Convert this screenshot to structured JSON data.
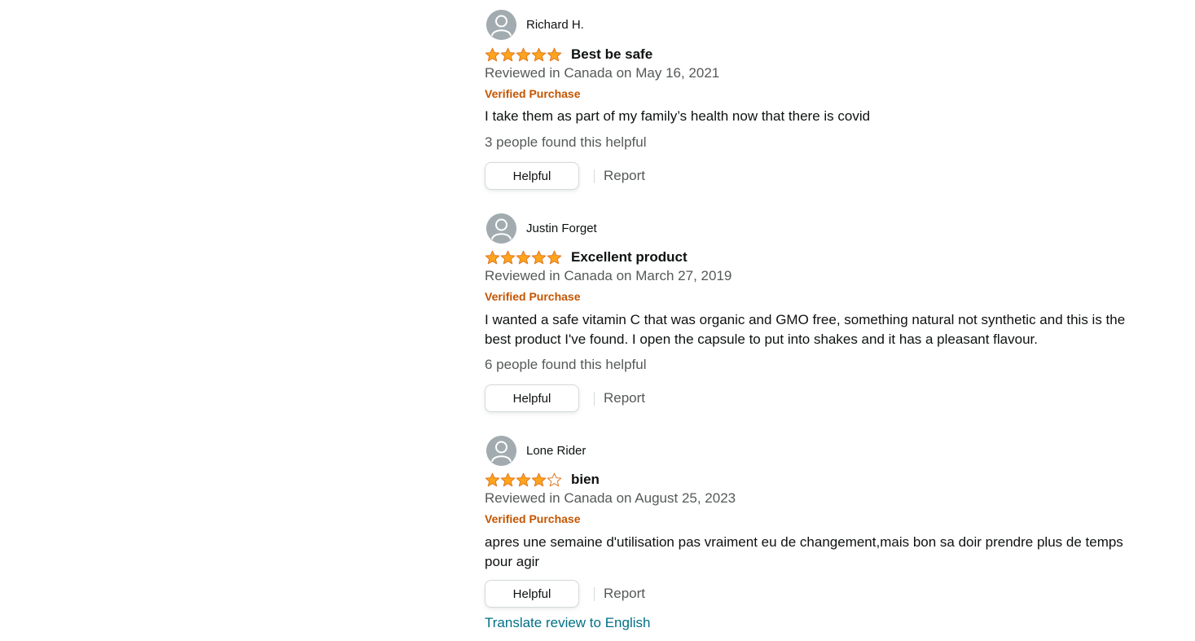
{
  "colors": {
    "star_fill": "#ffa41c",
    "star_outline": "#de7921",
    "verified": "#c45500",
    "link": "#007185",
    "secondary_text": "#565959"
  },
  "reviews": [
    {
      "reviewer": "Richard H.",
      "rating": 5,
      "rating_max": 5,
      "title": "Best be safe",
      "date": "Reviewed in Canada on May 16, 2021",
      "verified": "Verified Purchase",
      "body": "I take them as part of my family’s health now that there is covid",
      "helpful_count": "3 people found this helpful",
      "helpful_label": "Helpful",
      "report_label": "Report"
    },
    {
      "reviewer": "Justin Forget",
      "rating": 5,
      "rating_max": 5,
      "title": "Excellent product",
      "date": "Reviewed in Canada on March 27, 2019",
      "verified": "Verified Purchase",
      "body": "I wanted a safe vitamin C that was organic and GMO free, something natural not synthetic and this is the best product I've found. I open the capsule to put into shakes and it has a pleasant flavour.",
      "helpful_count": "6 people found this helpful",
      "helpful_label": "Helpful",
      "report_label": "Report"
    },
    {
      "reviewer": "Lone Rider",
      "rating": 4,
      "rating_max": 5,
      "title": "bien",
      "date": "Reviewed in Canada on August 25, 2023",
      "verified": "Verified Purchase",
      "body": "apres une semaine d'utilisation pas vraiment eu de changement,mais bon sa doir prendre plus de temps pour agir",
      "helpful_label": "Helpful",
      "report_label": "Report",
      "translate_label": "Translate review to English"
    }
  ]
}
